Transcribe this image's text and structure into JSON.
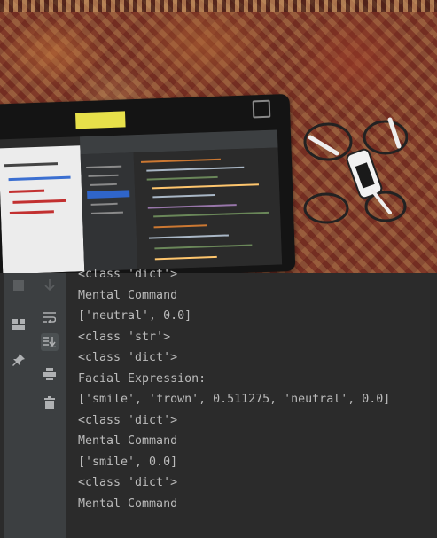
{
  "console": {
    "toolbar_left": [
      {
        "icon": "stop-icon"
      },
      {
        "icon": "layout-icon"
      },
      {
        "icon": "pin-icon"
      }
    ],
    "toolbar_mid": [
      {
        "icon": "scroll-down-icon"
      },
      {
        "icon": "soft-wrap-icon"
      },
      {
        "icon": "scroll-to-end-icon"
      },
      {
        "icon": "print-icon"
      },
      {
        "icon": "trash-icon"
      }
    ],
    "lines": [
      "<class 'dict'>",
      "Mental Command",
      "['neutral', 0.0]",
      "<class 'str'>",
      "<class 'dict'>",
      "Facial Expression:",
      "['smile', 'frown', 0.511275, 'neutral', 0.0]",
      "<class 'dict'>",
      "Mental Command",
      "['smile', 0.0]",
      "<class 'dict'>",
      "Mental Command"
    ]
  },
  "colors": {
    "console_bg": "#2b2b2b",
    "gutter_bg": "#3c3f41",
    "text": "#bbbbbb",
    "icon": "#9da2a6",
    "sticky_note": "#e7e04a"
  }
}
